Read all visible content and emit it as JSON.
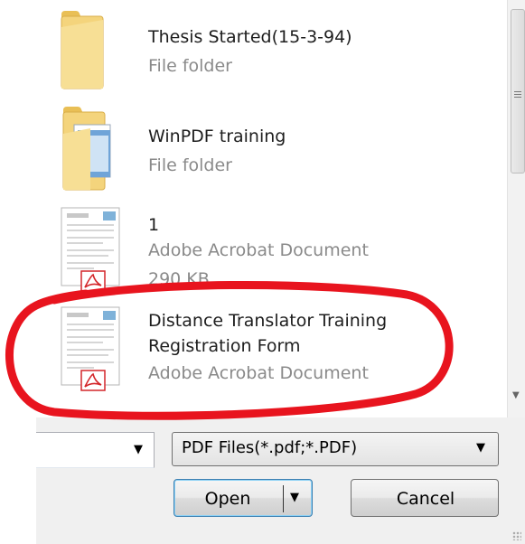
{
  "file_list": {
    "items": [
      {
        "name_lines": [
          "Thesis Started(15-3-94)"
        ],
        "type": "File folder",
        "size": "",
        "icon": "folder-icon"
      },
      {
        "name_lines": [
          "WinPDF training"
        ],
        "type": "File folder",
        "size": "",
        "icon": "folder-documents-icon"
      },
      {
        "name_lines": [
          "1"
        ],
        "type": "Adobe Acrobat Document",
        "size": "290 KB",
        "icon": "pdf-document-icon"
      },
      {
        "name_lines": [
          "Distance Translator Training",
          "Registration Form"
        ],
        "type": "Adobe Acrobat Document",
        "size": "",
        "icon": "pdf-document-icon"
      }
    ]
  },
  "footer": {
    "file_type_filter": "PDF Files(*.pdf;*.PDF)",
    "open_label": "Open",
    "cancel_label": "Cancel"
  },
  "icons": {
    "dropdown": "chevron-down-icon",
    "scroll_down": "scroll-down-arrow-icon",
    "scroll_grip": "scrollbar-grip-icon"
  },
  "colors": {
    "highlight": "#e8141e",
    "folder": "#f2d27a",
    "pdf_red": "#d4262a",
    "accent_border": "#3c7fb1"
  }
}
